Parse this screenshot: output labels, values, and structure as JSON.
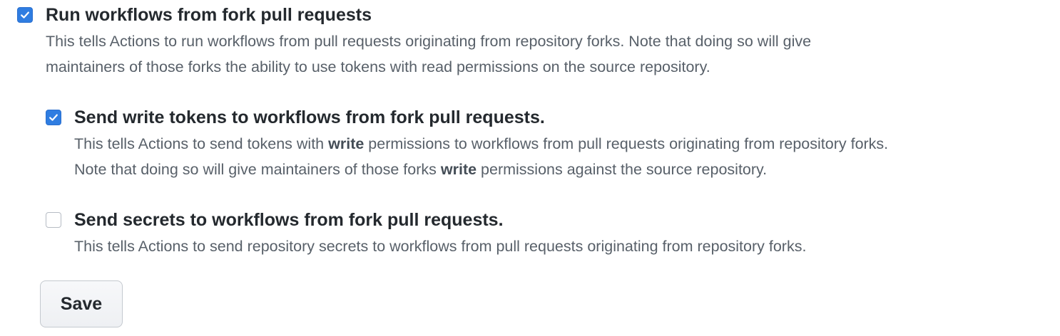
{
  "options": {
    "run_fork_workflows": {
      "checked": true,
      "title": "Run workflows from fork pull requests",
      "desc_line1": "This tells Actions to run workflows from pull requests originating from repository forks. Note that doing so will give",
      "desc_line2": "maintainers of those forks the ability to use tokens with read permissions on the source repository."
    },
    "send_write_tokens": {
      "checked": true,
      "title": "Send write tokens to workflows from fork pull requests.",
      "desc_line1_a": "This tells Actions to send tokens with ",
      "desc_line1_bold": "write",
      "desc_line1_b": " permissions to workflows from pull requests originating from repository forks.",
      "desc_line2_a": "Note that doing so will give maintainers of those forks ",
      "desc_line2_bold": "write",
      "desc_line2_b": " permissions against the source repository."
    },
    "send_secrets": {
      "checked": false,
      "title": "Send secrets to workflows from fork pull requests.",
      "desc_line1": "This tells Actions to send repository secrets to workflows from pull requests originating from repository forks."
    }
  },
  "save_label": "Save",
  "icons": {
    "checked": "check-icon"
  },
  "colors": {
    "checkbox_checked": "#2f7de1",
    "title_text": "#24292e",
    "desc_text": "#586069"
  }
}
